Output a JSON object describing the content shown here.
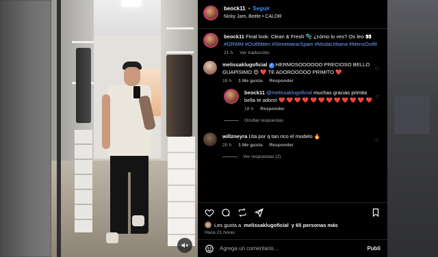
{
  "post": {
    "author": "beock11",
    "follow_label": "Seguir",
    "separator": "•",
    "audio": "Nicky Jam, Beéle • CALOR"
  },
  "caption": {
    "username": "beock11",
    "text": "Final look: Clean & Fresh 🫧 ¿cómo lo ves? Os leo 👀",
    "hashtags": "#GRWM #OutfitMen #StreetwearSpain #ModaUrbana #MensOutfit",
    "time": "21 h",
    "translate_label": "Ver traducción"
  },
  "comments": [
    {
      "username": "melissaklugoficial",
      "verified": true,
      "text": "HERMOSOOOOOO PRECIOSO BELLO GUAPÍSIMO 😍 ❤️ TE ADOROOOOO PRIMITO ❤️",
      "time": "18 h",
      "likes": "1 Me gusta",
      "reply_label": "Responder",
      "reply": {
        "username": "beock11",
        "mention": "@melissaklugoficial",
        "text": "muchas gracias primita bella te adoro! ❤️ ❤️ ❤️ ❤️ ❤️ ❤️ ❤️ ❤️ ❤️ ❤️ ❤️ ❤️",
        "time": "18 h",
        "reply_label": "Responder"
      },
      "hide_replies_label": "Ocultar respuestas"
    },
    {
      "username": "willzneyra",
      "text": "Uta por q tan rico el modelo 🔥",
      "time": "20 h",
      "likes": "1 Me gusta",
      "reply_label": "Responder",
      "view_replies_label": "Ver respuestas (2)"
    }
  ],
  "likes_line": {
    "prefix": "Les gusta a",
    "user": "melissaklugoficial",
    "suffix": "y 65 personas más"
  },
  "posted_ago": "Hace 21 horas",
  "composer": {
    "placeholder": "Agrega un comentario...",
    "publish_label": "Publi"
  },
  "colors": {
    "accent": "#3f8cff",
    "panel_bg": "#000000",
    "muted": "#a8a8a8"
  }
}
